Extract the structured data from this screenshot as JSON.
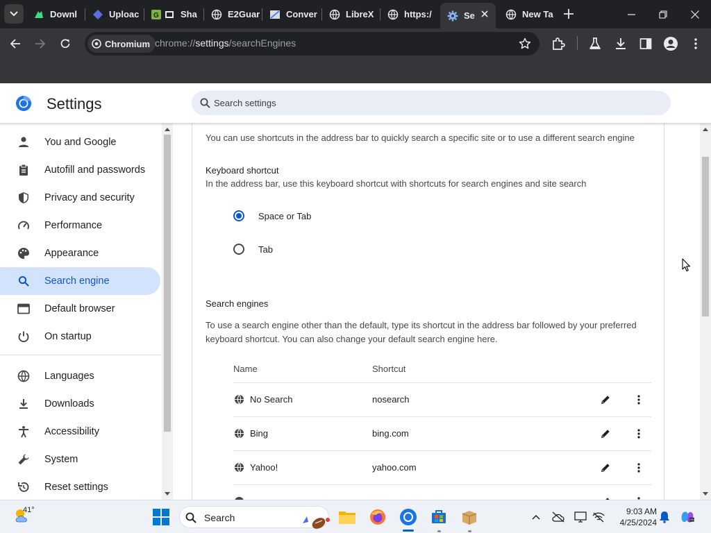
{
  "browser": {
    "tabs": [
      {
        "title": "Downl",
        "icon": "android-icon"
      },
      {
        "title": "Uploac",
        "icon": "upload-site-icon"
      },
      {
        "title": "Sha",
        "icon": "gallery-icon"
      },
      {
        "title": "E2Guar",
        "icon": "globe-icon"
      },
      {
        "title": "Conver",
        "icon": "converter-icon"
      },
      {
        "title": "LibreX",
        "icon": "globe-icon"
      },
      {
        "title": "https:/",
        "icon": "globe-icon"
      },
      {
        "title": "Se",
        "icon": "gear-icon",
        "active": true
      },
      {
        "title": "New Ta",
        "icon": "globe-icon"
      }
    ],
    "chip_label": "Chromium",
    "url_prefix": "chrome://",
    "url_host": "settings",
    "url_path": "/searchEngines"
  },
  "settings": {
    "title": "Settings",
    "search_placeholder": "Search settings",
    "nav": [
      {
        "label": "You and Google",
        "icon": "person-icon"
      },
      {
        "label": "Autofill and passwords",
        "icon": "clipboard-icon"
      },
      {
        "label": "Privacy and security",
        "icon": "shield-icon"
      },
      {
        "label": "Performance",
        "icon": "speedometer-icon"
      },
      {
        "label": "Appearance",
        "icon": "palette-icon"
      },
      {
        "label": "Search engine",
        "icon": "search-icon",
        "selected": true
      },
      {
        "label": "Default browser",
        "icon": "browser-window-icon"
      },
      {
        "label": "On startup",
        "icon": "power-icon"
      },
      {
        "label": "Languages",
        "icon": "globe-icon"
      },
      {
        "label": "Downloads",
        "icon": "download-icon"
      },
      {
        "label": "Accessibility",
        "icon": "accessibility-icon"
      },
      {
        "label": "System",
        "icon": "wrench-icon"
      },
      {
        "label": "Reset settings",
        "icon": "reset-icon"
      }
    ],
    "intro": "You can use shortcuts in the address bar to quickly search a specific site or to use a different search engine",
    "keyboard_shortcut": {
      "heading": "Keyboard shortcut",
      "description": "In the address bar, use this keyboard shortcut with shortcuts for search engines and site search",
      "options": [
        {
          "label": "Space or Tab",
          "checked": true
        },
        {
          "label": "Tab",
          "checked": false
        }
      ]
    },
    "search_engines": {
      "heading": "Search engines",
      "description": "To use a search engine other than the default, type its shortcut in the address bar followed by your preferred keyboard shortcut. You can also change your default search engine here.",
      "col_name": "Name",
      "col_shortcut": "Shortcut",
      "rows": [
        {
          "name": "No Search",
          "shortcut": "nosearch"
        },
        {
          "name": "Bing",
          "shortcut": "bing.com"
        },
        {
          "name": "Yahoo!",
          "shortcut": "yahoo.com"
        }
      ]
    }
  },
  "taskbar": {
    "temperature": "41°",
    "search_label": "Search",
    "time": "9:03 AM",
    "date": "4/25/2024"
  },
  "colors": {
    "accent": "#0b57d0",
    "selected_nav_bg": "#d3e3fd",
    "chrome_dark": "#202124",
    "toolbar": "#35363a"
  }
}
